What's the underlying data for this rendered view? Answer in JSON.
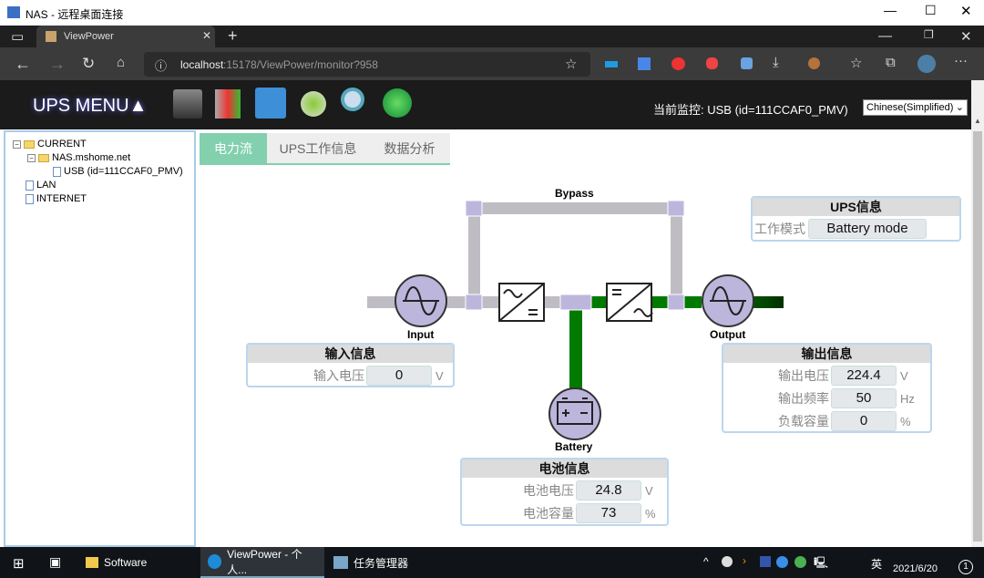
{
  "window": {
    "title": "NAS - 远程桌面连接"
  },
  "browser": {
    "tab_title": "ViewPower",
    "url_host": "localhost",
    "url_rest": ":15178/ViewPower/monitor?958"
  },
  "header": {
    "menu_label": "UPS MENU▲",
    "monitor_label": "当前监控: USB (id=111CCAF0_PMV)",
    "language": "Chinese(Simplified)"
  },
  "tree": {
    "current": "CURRENT",
    "host": "NAS.mshome.net",
    "device": "USB (id=111CCAF0_PMV)",
    "lan": "LAN",
    "internet": "INTERNET"
  },
  "tabs": [
    "电力流",
    "UPS工作信息",
    "数据分析"
  ],
  "diagram": {
    "bypass": "Bypass",
    "input": "Input",
    "output": "Output",
    "battery": "Battery",
    "active_color": "#007a00",
    "inactive_color": "#c0bcc4"
  },
  "ups_info": {
    "title": "UPS信息",
    "mode_label": "工作模式",
    "mode": "Battery mode"
  },
  "input_info": {
    "title": "输入信息",
    "voltage_label": "输入电压",
    "voltage": "0",
    "voltage_unit": "V"
  },
  "output_info": {
    "title": "输出信息",
    "voltage_label": "输出电压",
    "voltage": "224.4",
    "voltage_unit": "V",
    "freq_label": "输出频率",
    "freq": "50",
    "freq_unit": "Hz",
    "load_label": "负载容量",
    "load": "0",
    "load_unit": "%"
  },
  "battery_info": {
    "title": "电池信息",
    "voltage_label": "电池电压",
    "voltage": "24.8",
    "voltage_unit": "V",
    "capacity_label": "电池容量",
    "capacity": "73",
    "capacity_unit": "%"
  },
  "taskbar": {
    "items": [
      "Software",
      "ViewPower - 个人...",
      "任务管理器"
    ],
    "date": "2021/6/20",
    "ime": "英",
    "notifications": "1"
  }
}
